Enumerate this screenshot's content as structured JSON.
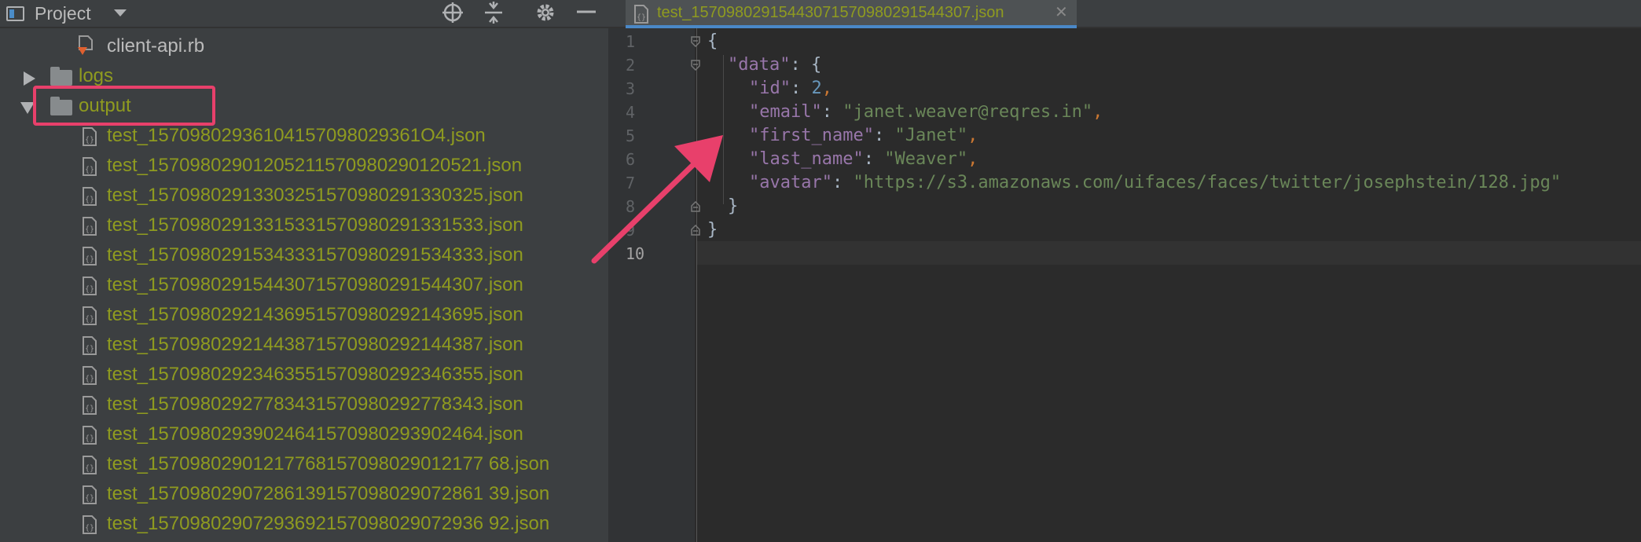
{
  "project_panel": {
    "title": "Project",
    "toolbar_icons": [
      "locate-icon",
      "collapse-all-icon",
      "gear-icon",
      "minimize-icon"
    ],
    "tree": [
      {
        "label": "client-api.rb",
        "type": "ruby-file",
        "depth": 2
      },
      {
        "label": "logs",
        "type": "folder",
        "expanded": false
      },
      {
        "label": "output",
        "type": "folder",
        "expanded": true
      },
      {
        "label": "test_15709802936104157098029361O4.json",
        "type": "json-file"
      },
      {
        "label": "test_15709802901205211570980290120521.json",
        "type": "json-file"
      },
      {
        "label": "test_15709802913303251570980291330325.json",
        "type": "json-file"
      },
      {
        "label": "test_15709802913315331570980291331533.json",
        "type": "json-file"
      },
      {
        "label": "test_15709802915343331570980291534333.json",
        "type": "json-file"
      },
      {
        "label": "test_15709802915443071570980291544307.json",
        "type": "json-file"
      },
      {
        "label": "test_15709802921436951570980292143695.json",
        "type": "json-file"
      },
      {
        "label": "test_15709802921443871570980292144387.json",
        "type": "json-file"
      },
      {
        "label": "test_15709802923463551570980292346355.json",
        "type": "json-file"
      },
      {
        "label": "test_15709802927783431570980292778343.json",
        "type": "json-file"
      },
      {
        "label": "test_15709802939024641570980293902464.json",
        "type": "json-file"
      },
      {
        "label": "test_15709802901217768157098029012177 68.json",
        "type": "json-file"
      },
      {
        "label": "test_15709802907286139157098029072861 39.json",
        "type": "json-file"
      },
      {
        "label": "test_15709802907293692157098029072936 92.json",
        "type": "json-file"
      }
    ]
  },
  "editor": {
    "tab_label": "test_15709802915443071570980291544307.json",
    "line_numbers": [
      "1",
      "2",
      "3",
      "4",
      "5",
      "6",
      "7",
      "8",
      "9",
      "10"
    ],
    "code": {
      "open_brace": "{",
      "data_key": "\"data\"",
      "colon": ":",
      "id_key": "\"id\"",
      "id_value": "2",
      "email_key": "\"email\"",
      "email_value": "\"janet.weaver@reqres.in\"",
      "first_name_key": "\"first_name\"",
      "first_name_value": "\"Janet\"",
      "last_name_key": "\"last_name\"",
      "last_name_value": "\"Weaver\"",
      "avatar_key": "\"avatar\"",
      "avatar_value": "\"https://s3.amazonaws.com/uifaces/faces/twitter/josephstein/128.jpg\"",
      "comma": ",",
      "close_brace": "}"
    }
  },
  "colors": {
    "annotation": "#e8406b",
    "output_files": "#8f9b20",
    "json_key": "#9876aa",
    "json_string": "#6a8759",
    "json_number": "#6897bb"
  }
}
